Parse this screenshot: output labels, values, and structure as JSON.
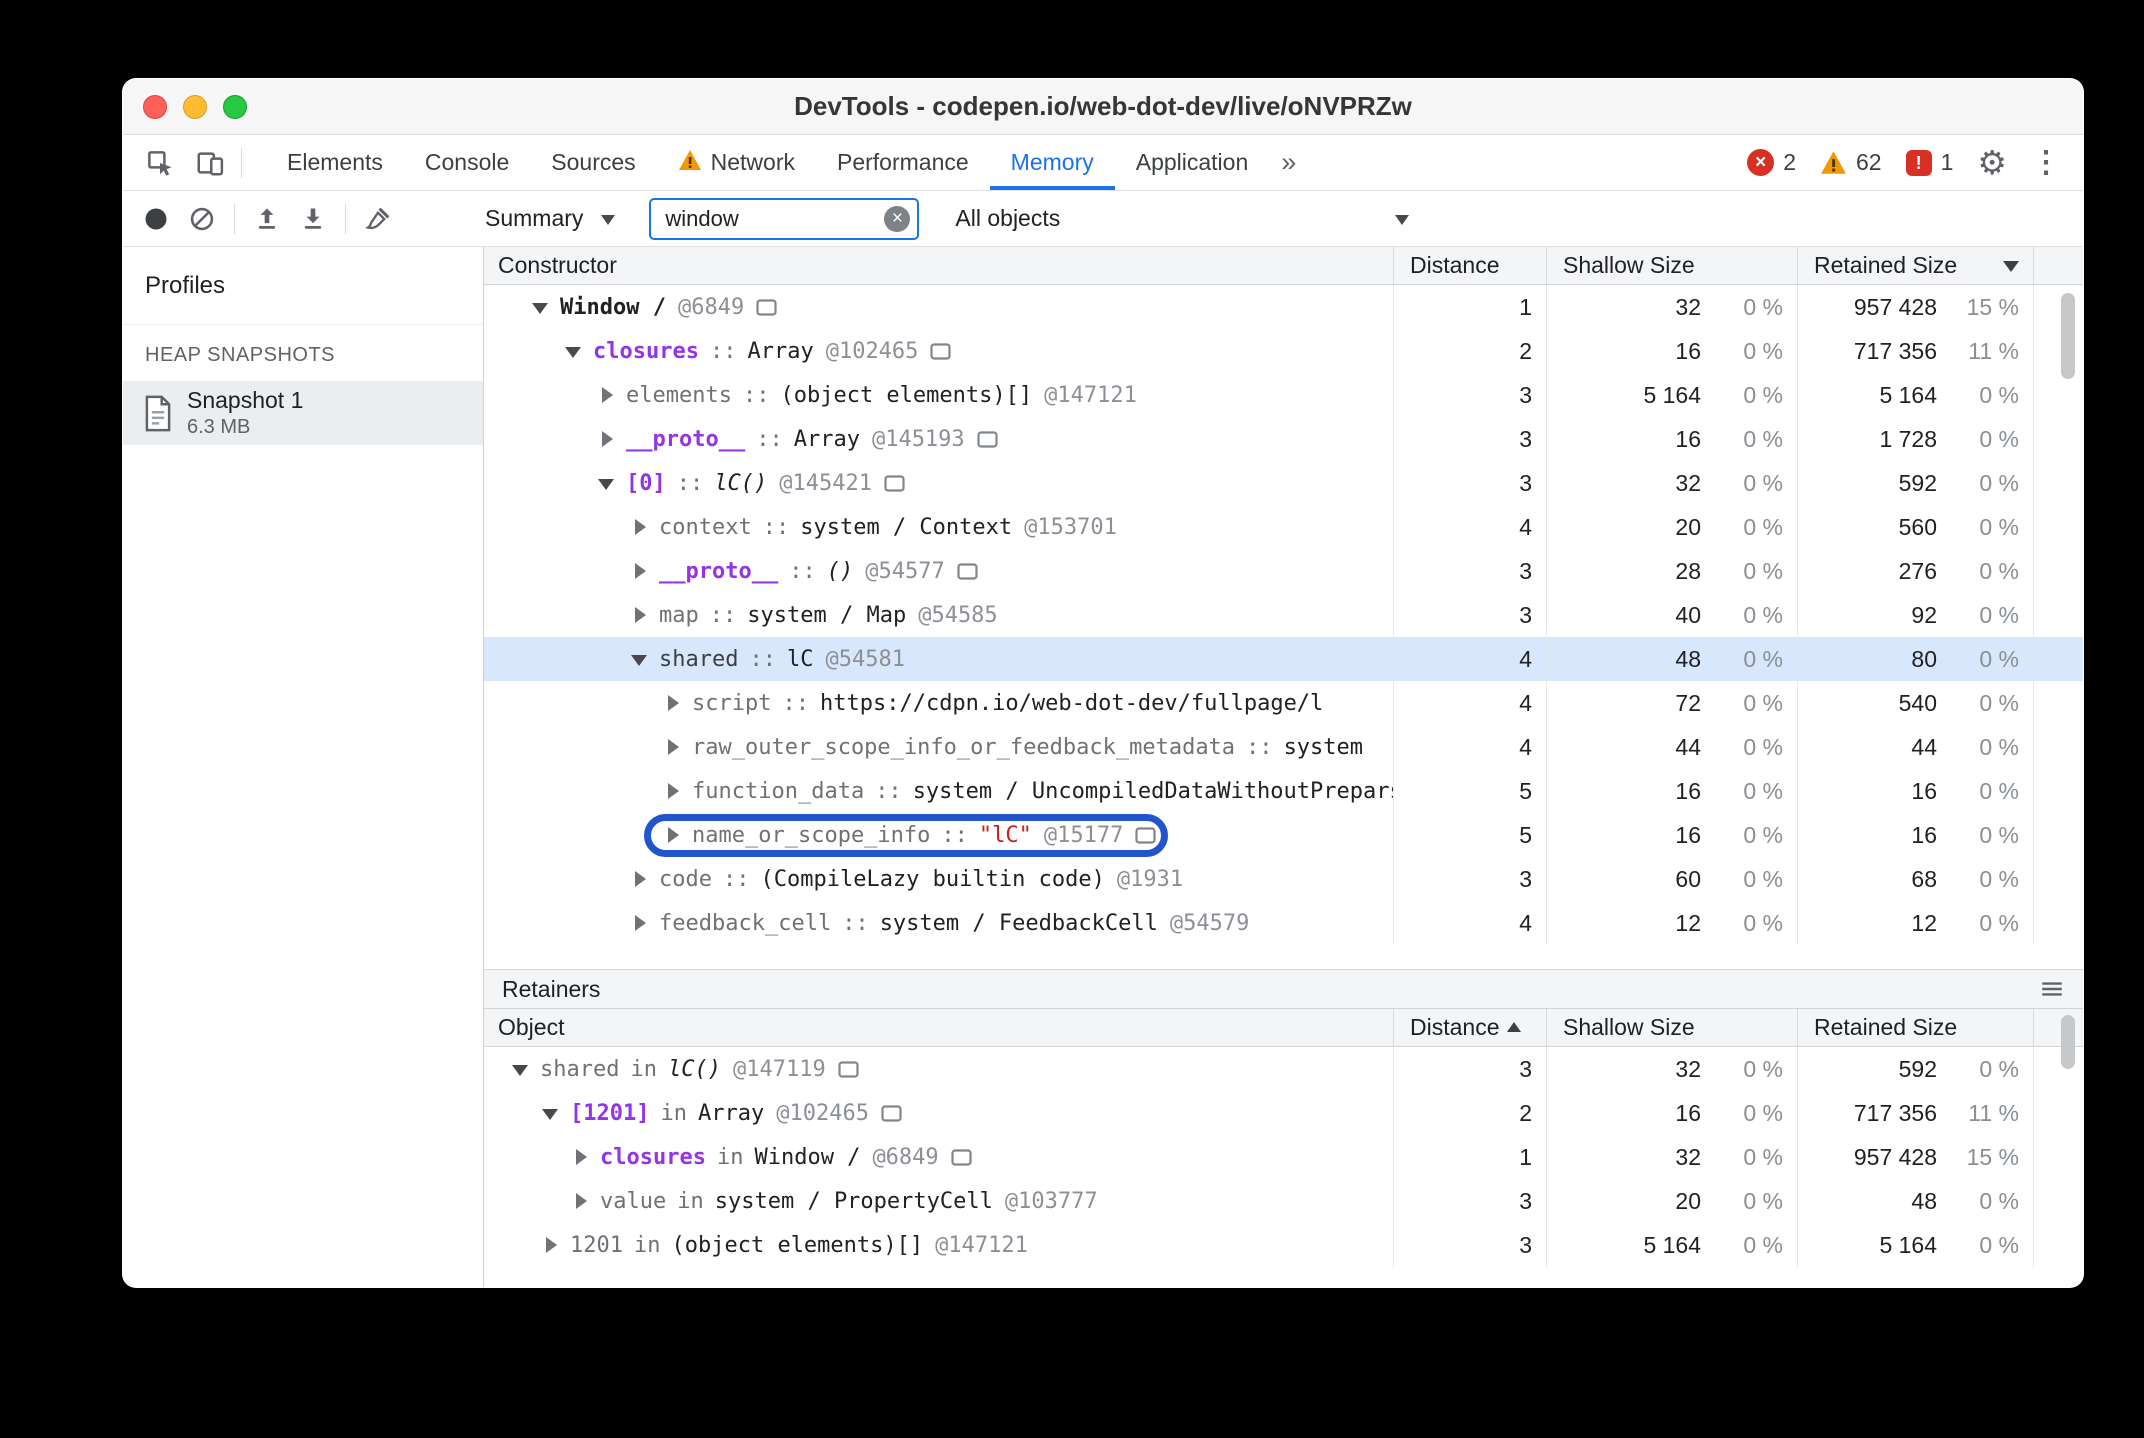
{
  "colors": {
    "accent_blue": "#1a73e8",
    "selection_blue": "#d9e7fd",
    "annotation_blue": "#2255cc",
    "property_purple": "#9334e6",
    "string_red": "#c5221f",
    "error_red": "#d93025",
    "warning_amber": "#f29900"
  },
  "window": {
    "title": "DevTools - codepen.io/web-dot-dev/live/oNVPRZw"
  },
  "tabs": {
    "items": [
      {
        "label": "Elements"
      },
      {
        "label": "Console"
      },
      {
        "label": "Sources"
      },
      {
        "label": "Network",
        "warning": true
      },
      {
        "label": "Performance"
      },
      {
        "label": "Memory",
        "active": true
      },
      {
        "label": "Application"
      }
    ],
    "more_label": "»",
    "error_count": "2",
    "warning_count": "62",
    "issue_count": "1"
  },
  "toolbar": {
    "profile_type_label": "Summary",
    "search_value": "window",
    "class_filter_label": "All objects"
  },
  "sidebar": {
    "title": "Profiles",
    "section": "HEAP SNAPSHOTS",
    "snapshot_name": "Snapshot 1",
    "snapshot_size": "6.3 MB"
  },
  "constructor_panel": {
    "columns": {
      "constructor": "Constructor",
      "distance": "Distance",
      "shallow": "Shallow Size",
      "retained": "Retained Size"
    },
    "sort": "retained-descending",
    "rows": [
      {
        "depth": 0,
        "expanded": true,
        "name": "Window /",
        "nameStyle": "object",
        "sep": null,
        "value": null,
        "valueStyle": null,
        "id": "@6849",
        "reveal": true,
        "selected": false,
        "circled": false,
        "distance": "1",
        "shallow": "32",
        "shallowPct": "0 %",
        "retained": "957 428",
        "retainedPct": "15 %"
      },
      {
        "depth": 1,
        "expanded": true,
        "name": "closures",
        "nameStyle": "special",
        "sep": "::",
        "value": "Array",
        "valueStyle": "plain",
        "id": "@102465",
        "reveal": true,
        "selected": false,
        "circled": false,
        "distance": "2",
        "shallow": "16",
        "shallowPct": "0 %",
        "retained": "717 356",
        "retainedPct": "11 %"
      },
      {
        "depth": 2,
        "expanded": false,
        "name": "elements",
        "nameStyle": "system",
        "sep": "::",
        "value": "(object elements)[]",
        "valueStyle": "plain",
        "id": "@147121",
        "reveal": false,
        "selected": false,
        "circled": false,
        "distance": "3",
        "shallow": "5 164",
        "shallowPct": "0 %",
        "retained": "5 164",
        "retainedPct": "0 %"
      },
      {
        "depth": 2,
        "expanded": false,
        "name": "__proto__",
        "nameStyle": "special",
        "sep": "::",
        "value": "Array",
        "valueStyle": "plain",
        "id": "@145193",
        "reveal": true,
        "selected": false,
        "circled": false,
        "distance": "3",
        "shallow": "16",
        "shallowPct": "0 %",
        "retained": "1 728",
        "retainedPct": "0 %"
      },
      {
        "depth": 2,
        "expanded": true,
        "name": "[0]",
        "nameStyle": "special",
        "sep": "::",
        "value": "lC()",
        "valueStyle": "italic",
        "id": "@145421",
        "reveal": true,
        "selected": false,
        "circled": false,
        "distance": "3",
        "shallow": "32",
        "shallowPct": "0 %",
        "retained": "592",
        "retainedPct": "0 %"
      },
      {
        "depth": 3,
        "expanded": false,
        "name": "context",
        "nameStyle": "system",
        "sep": "::",
        "value": "system / Context",
        "valueStyle": "plain",
        "id": "@153701",
        "reveal": false,
        "selected": false,
        "circled": false,
        "distance": "4",
        "shallow": "20",
        "shallowPct": "0 %",
        "retained": "560",
        "retainedPct": "0 %"
      },
      {
        "depth": 3,
        "expanded": false,
        "name": "__proto__",
        "nameStyle": "special",
        "sep": "::",
        "value": "()",
        "valueStyle": "italic",
        "id": "@54577",
        "reveal": true,
        "selected": false,
        "circled": false,
        "distance": "3",
        "shallow": "28",
        "shallowPct": "0 %",
        "retained": "276",
        "retainedPct": "0 %"
      },
      {
        "depth": 3,
        "expanded": false,
        "name": "map",
        "nameStyle": "system",
        "sep": "::",
        "value": "system / Map",
        "valueStyle": "plain",
        "id": "@54585",
        "reveal": false,
        "selected": false,
        "circled": false,
        "distance": "3",
        "shallow": "40",
        "shallowPct": "0 %",
        "retained": "92",
        "retainedPct": "0 %"
      },
      {
        "depth": 3,
        "expanded": true,
        "name": "shared",
        "nameStyle": "system",
        "sep": "::",
        "value": "lC",
        "valueStyle": "plain",
        "id": "@54581",
        "reveal": false,
        "selected": true,
        "circled": false,
        "distance": "4",
        "shallow": "48",
        "shallowPct": "0 %",
        "retained": "80",
        "retainedPct": "0 %"
      },
      {
        "depth": 4,
        "expanded": false,
        "name": "script",
        "nameStyle": "system",
        "sep": "::",
        "value": "https://cdpn.io/web-dot-dev/fullpage/l",
        "valueStyle": "plain",
        "id": null,
        "reveal": false,
        "selected": false,
        "circled": false,
        "distance": "4",
        "shallow": "72",
        "shallowPct": "0 %",
        "retained": "540",
        "retainedPct": "0 %"
      },
      {
        "depth": 4,
        "expanded": false,
        "name": "raw_outer_scope_info_or_feedback_metadata",
        "nameStyle": "system",
        "sep": "::",
        "value": "system",
        "valueStyle": "plain",
        "id": null,
        "reveal": false,
        "selected": false,
        "circled": false,
        "distance": "4",
        "shallow": "44",
        "shallowPct": "0 %",
        "retained": "44",
        "retainedPct": "0 %"
      },
      {
        "depth": 4,
        "expanded": false,
        "name": "function_data",
        "nameStyle": "system",
        "sep": "::",
        "value": "system / UncompiledDataWithoutPreparseData",
        "valueStyle": "plain",
        "id": null,
        "reveal": false,
        "selected": false,
        "circled": false,
        "distance": "5",
        "shallow": "16",
        "shallowPct": "0 %",
        "retained": "16",
        "retainedPct": "0 %"
      },
      {
        "depth": 4,
        "expanded": false,
        "name": "name_or_scope_info",
        "nameStyle": "system",
        "sep": "::",
        "value": "\"lC\"",
        "valueStyle": "string",
        "id": "@15177",
        "reveal": true,
        "selected": false,
        "circled": true,
        "distance": "5",
        "shallow": "16",
        "shallowPct": "0 %",
        "retained": "16",
        "retainedPct": "0 %"
      },
      {
        "depth": 3,
        "expanded": false,
        "name": "code",
        "nameStyle": "system",
        "sep": "::",
        "value": "(CompileLazy builtin code)",
        "valueStyle": "plain",
        "id": "@1931",
        "reveal": false,
        "selected": false,
        "circled": false,
        "distance": "3",
        "shallow": "60",
        "shallowPct": "0 %",
        "retained": "68",
        "retainedPct": "0 %"
      },
      {
        "depth": 3,
        "expanded": false,
        "name": "feedback_cell",
        "nameStyle": "system",
        "sep": "::",
        "value": "system / FeedbackCell",
        "valueStyle": "plain",
        "id": "@54579",
        "reveal": false,
        "selected": false,
        "circled": false,
        "distance": "4",
        "shallow": "12",
        "shallowPct": "0 %",
        "retained": "12",
        "retainedPct": "0 %"
      }
    ]
  },
  "retainers_panel": {
    "title": "Retainers",
    "columns": {
      "object": "Object",
      "distance": "Distance",
      "shallow": "Shallow Size",
      "retained": "Retained Size"
    },
    "sort": "distance-ascending",
    "rows": [
      {
        "depth": 0,
        "expanded": true,
        "name": "shared",
        "nameStyle": "system",
        "sep": "in",
        "value": "lC()",
        "valueStyle": "italic",
        "id": "@147119",
        "reveal": true,
        "selected": false,
        "circled": false,
        "distance": "3",
        "shallow": "32",
        "shallowPct": "0 %",
        "retained": "592",
        "retainedPct": "0 %"
      },
      {
        "depth": 1,
        "expanded": true,
        "name": "[1201]",
        "nameStyle": "special",
        "sep": "in",
        "value": "Array",
        "valueStyle": "plain",
        "id": "@102465",
        "reveal": true,
        "selected": false,
        "circled": false,
        "distance": "2",
        "shallow": "16",
        "shallowPct": "0 %",
        "retained": "717 356",
        "retainedPct": "11 %"
      },
      {
        "depth": 2,
        "expanded": false,
        "name": "closures",
        "nameStyle": "special",
        "sep": "in",
        "value": "Window /",
        "valueStyle": "plain",
        "id": "@6849",
        "reveal": true,
        "selected": false,
        "circled": false,
        "distance": "1",
        "shallow": "32",
        "shallowPct": "0 %",
        "retained": "957 428",
        "retainedPct": "15 %"
      },
      {
        "depth": 2,
        "expanded": false,
        "name": "value",
        "nameStyle": "system",
        "sep": "in",
        "value": "system / PropertyCell",
        "valueStyle": "plain",
        "id": "@103777",
        "reveal": false,
        "selected": false,
        "circled": false,
        "distance": "3",
        "shallow": "20",
        "shallowPct": "0 %",
        "retained": "48",
        "retainedPct": "0 %"
      },
      {
        "depth": 1,
        "expanded": false,
        "name": "1201",
        "nameStyle": "system",
        "sep": "in",
        "value": "(object elements)[]",
        "valueStyle": "plain",
        "id": "@147121",
        "reveal": false,
        "selected": false,
        "circled": false,
        "distance": "3",
        "shallow": "5 164",
        "shallowPct": "0 %",
        "retained": "5 164",
        "retainedPct": "0 %"
      }
    ]
  }
}
